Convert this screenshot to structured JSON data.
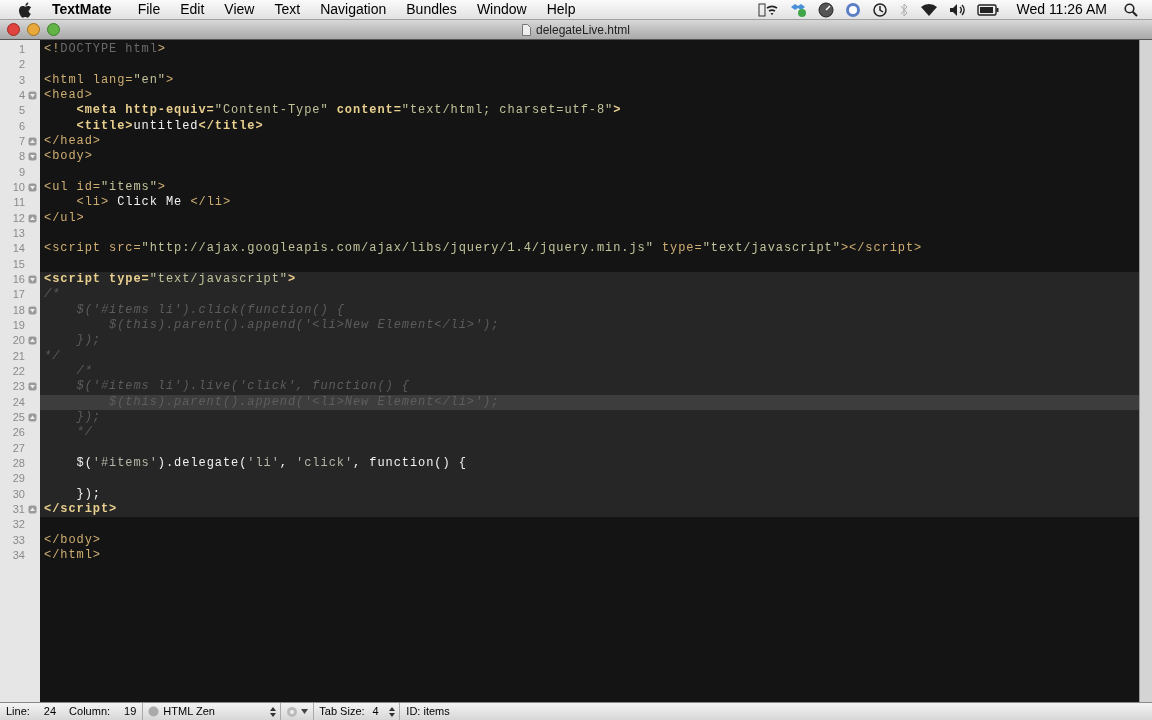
{
  "menu_bar": {
    "app": "TextMate",
    "items": [
      "File",
      "Edit",
      "View",
      "Text",
      "Navigation",
      "Bundles",
      "Window",
      "Help"
    ],
    "clock": "Wed 11:26 AM"
  },
  "window": {
    "title": "delegateLive.html"
  },
  "editor": {
    "sections": [
      {
        "embedded": false,
        "lines": [
          {
            "n": "1",
            "kind": "plain",
            "current": false,
            "tokens": [
              {
                "text": "<!",
                "kind": "tag"
              },
              {
                "text": "DOCTYPE html",
                "kind": "doctype"
              },
              {
                "text": ">",
                "kind": "tag"
              }
            ]
          },
          {
            "n": "2",
            "kind": "plain",
            "current": false
          },
          {
            "n": "3",
            "kind": "plain",
            "current": false,
            "tokens": [
              {
                "text": "<html lang=",
                "kind": "tag"
              },
              {
                "text": "\"en\"",
                "kind": "string"
              },
              {
                "text": ">",
                "kind": "tag"
              }
            ]
          },
          {
            "n": "4",
            "kind": "fold-start",
            "current": false,
            "tokens": [
              {
                "text": "<head>",
                "kind": "tag"
              }
            ]
          },
          {
            "n": "5",
            "kind": "plain",
            "current": false,
            "tokens": [
              {
                "text": "    <meta http-equiv=",
                "kind": "strong-tag"
              },
              {
                "text": "\"Content-Type\"",
                "kind": "string"
              },
              {
                "text": " content=",
                "kind": "strong-tag"
              },
              {
                "text": "\"text/html; charset=utf-8\"",
                "kind": "string"
              },
              {
                "text": ">",
                "kind": "strong-tag"
              }
            ]
          },
          {
            "n": "6",
            "kind": "plain",
            "current": false,
            "tokens": [
              {
                "text": "    <title>",
                "kind": "strong-tag"
              },
              {
                "text": "untitled",
                "kind": "text"
              },
              {
                "text": "</title>",
                "kind": "strong-tag"
              }
            ]
          },
          {
            "n": "7",
            "kind": "fold-end",
            "current": false,
            "tokens": [
              {
                "text": "</head>",
                "kind": "tag"
              }
            ]
          },
          {
            "n": "8",
            "kind": "fold-start",
            "current": false,
            "tokens": [
              {
                "text": "<body>",
                "kind": "tag"
              }
            ]
          },
          {
            "n": "9",
            "kind": "plain",
            "current": false
          },
          {
            "n": "10",
            "kind": "fold-start",
            "current": false,
            "tokens": [
              {
                "text": "<ul id=",
                "kind": "tag"
              },
              {
                "text": "\"items\"",
                "kind": "string"
              },
              {
                "text": ">",
                "kind": "tag"
              }
            ]
          },
          {
            "n": "11",
            "kind": "plain",
            "current": false,
            "tokens": [
              {
                "text": "    <li>",
                "kind": "tag"
              },
              {
                "text": " Click Me ",
                "kind": "text"
              },
              {
                "text": "</li>",
                "kind": "tag"
              }
            ]
          },
          {
            "n": "12",
            "kind": "fold-end",
            "current": false,
            "tokens": [
              {
                "text": "</ul>",
                "kind": "tag"
              }
            ]
          },
          {
            "n": "13",
            "kind": "plain",
            "current": false
          },
          {
            "n": "14",
            "kind": "plain",
            "current": false,
            "tokens": [
              {
                "text": "<script src=",
                "kind": "tag"
              },
              {
                "text": "\"http://ajax.googleapis.com/ajax/libs/jquery/1.4/jquery.min.js\"",
                "kind": "string"
              },
              {
                "text": " type=",
                "kind": "tag"
              },
              {
                "text": "\"text/javascript\"",
                "kind": "string"
              },
              {
                "text": "></script>",
                "kind": "tag"
              }
            ]
          },
          {
            "n": "15",
            "kind": "plain",
            "current": false
          }
        ]
      },
      {
        "embedded": true,
        "lines": [
          {
            "n": "16",
            "kind": "fold-start",
            "current": false,
            "tokens": [
              {
                "text": "<script type=",
                "kind": "strong-tag"
              },
              {
                "text": "\"text/javascript\"",
                "kind": "string"
              },
              {
                "text": ">",
                "kind": "strong-tag"
              }
            ]
          },
          {
            "n": "17",
            "kind": "plain",
            "current": false,
            "tokens": [
              {
                "text": "/*",
                "kind": "comment"
              }
            ]
          },
          {
            "n": "18",
            "kind": "fold-start",
            "current": false,
            "tokens": [
              {
                "text": "    $('#items li').click(function() {",
                "kind": "comment"
              }
            ]
          },
          {
            "n": "19",
            "kind": "plain",
            "current": false,
            "tokens": [
              {
                "text": "        $(this).parent().append('<li>New Element</li>');",
                "kind": "comment"
              }
            ]
          },
          {
            "n": "20",
            "kind": "fold-end",
            "current": false,
            "tokens": [
              {
                "text": "    });",
                "kind": "comment"
              }
            ]
          },
          {
            "n": "21",
            "kind": "plain",
            "current": false,
            "tokens": [
              {
                "text": "*/",
                "kind": "comment"
              }
            ]
          },
          {
            "n": "22",
            "kind": "plain",
            "current": false,
            "tokens": [
              {
                "text": "    /*",
                "kind": "comment"
              }
            ]
          },
          {
            "n": "23",
            "kind": "fold-start",
            "current": false,
            "tokens": [
              {
                "text": "    $('#items li').live('click', function() {",
                "kind": "comment"
              }
            ]
          },
          {
            "n": "24",
            "kind": "plain",
            "current": true,
            "tokens": [
              {
                "text": "        $(this).parent().append('<li>New Element</li>');",
                "kind": "comment"
              }
            ]
          },
          {
            "n": "25",
            "kind": "fold-end",
            "current": false,
            "tokens": [
              {
                "text": "    });",
                "kind": "comment"
              }
            ]
          },
          {
            "n": "26",
            "kind": "plain",
            "current": false,
            "tokens": [
              {
                "text": "    */",
                "kind": "comment"
              }
            ]
          },
          {
            "n": "27",
            "kind": "plain",
            "current": false
          },
          {
            "n": "28",
            "kind": "plain",
            "current": false,
            "tokens": [
              {
                "text": "    $(",
                "kind": "text"
              },
              {
                "text": "'#items'",
                "kind": "js-string"
              },
              {
                "text": ").delegate(",
                "kind": "text"
              },
              {
                "text": "'li'",
                "kind": "js-string"
              },
              {
                "text": ", ",
                "kind": "text"
              },
              {
                "text": "'click'",
                "kind": "js-string"
              },
              {
                "text": ", function() {",
                "kind": "text"
              }
            ]
          },
          {
            "n": "29",
            "kind": "plain",
            "current": false
          },
          {
            "n": "30",
            "kind": "plain",
            "current": false,
            "tokens": [
              {
                "text": "    });",
                "kind": "text"
              }
            ]
          },
          {
            "n": "31",
            "kind": "fold-end",
            "current": false,
            "tokens": [
              {
                "text": "</script>",
                "kind": "strong-tag"
              }
            ]
          }
        ]
      },
      {
        "embedded": false,
        "lines": [
          {
            "n": "32",
            "kind": "plain",
            "current": false
          },
          {
            "n": "33",
            "kind": "plain",
            "current": false,
            "tokens": [
              {
                "text": "</body>",
                "kind": "tag"
              }
            ]
          },
          {
            "n": "34",
            "kind": "plain",
            "current": false,
            "tokens": [
              {
                "text": "</html>",
                "kind": "tag"
              }
            ]
          }
        ]
      }
    ]
  },
  "status_bar": {
    "line_label": "Line:",
    "line": "24",
    "column_label": "Column:",
    "column": "19",
    "language": "HTML Zen",
    "tab_size_label": "Tab Size:",
    "tab_size": "4",
    "symbol": "ID: items"
  }
}
